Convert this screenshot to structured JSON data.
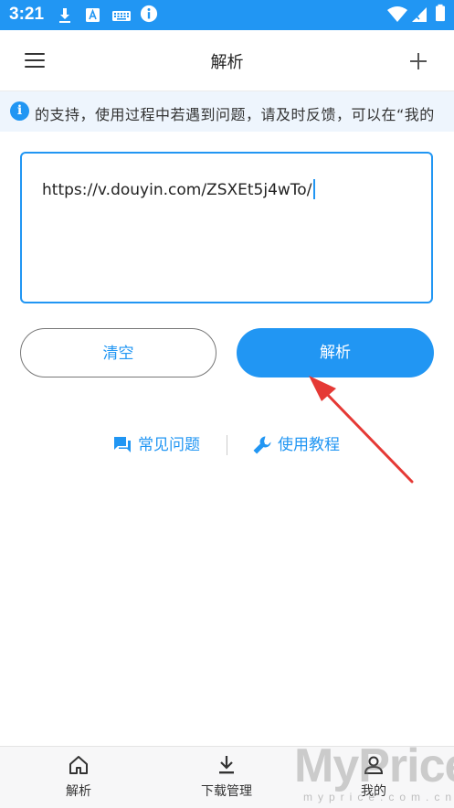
{
  "status_bar": {
    "time": "3:21",
    "icons": [
      "download-icon",
      "translate-a-icon",
      "keyboard-icon",
      "info-icon",
      "wifi-icon",
      "signal-icon",
      "battery-icon"
    ]
  },
  "app_bar": {
    "title": "解析",
    "menu_icon": "menu-icon",
    "add_icon": "plus-icon"
  },
  "notice": {
    "text": "的支持，使用过程中若遇到问题，请及时反馈，可以在“我的"
  },
  "input": {
    "value": "https://v.douyin.com/ZSXEt5j4wTo/"
  },
  "buttons": {
    "clear_label": "清空",
    "parse_label": "解析"
  },
  "help": {
    "faq_label": "常见问题",
    "tutorial_label": "使用教程"
  },
  "bottom_nav": {
    "items": [
      {
        "label": "解析",
        "icon": "home-icon"
      },
      {
        "label": "下载管理",
        "icon": "download-tray-icon"
      },
      {
        "label": "我的",
        "icon": "person-icon"
      }
    ]
  },
  "watermark": {
    "brand": "MyPrice",
    "domain": "myprice.com.cn"
  },
  "colors": {
    "accent": "#2196f3",
    "arrow": "#e53935"
  }
}
